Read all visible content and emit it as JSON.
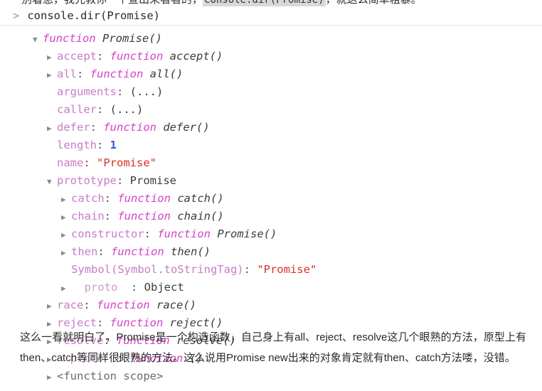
{
  "article": {
    "top_clipped_line": {
      "before_code": "别着急，我先教你一个查出来看看的，",
      "code": "console.dir(Promise)",
      "after_code": "，就这么简单粗暴。"
    },
    "bottom_paragraph": "这么一看就明白了，Promise是一个构造函数，自己身上有all、reject、resolve这几个眼熟的方法，原型上有then、catch等同样很眼熟的方法。这么说用Promise new出来的对象肯定就有then、catch方法喽，没错。"
  },
  "console": {
    "prompt_caret": ">",
    "input_text": "console.dir(Promise)",
    "tree": [
      {
        "level": 0,
        "arrow": "open",
        "kw": "function",
        "fname": "Promise()"
      },
      {
        "level": 1,
        "arrow": "closed",
        "prop": "accept",
        "sep": ": ",
        "kw": "function",
        "fname": "accept()"
      },
      {
        "level": 1,
        "arrow": "closed",
        "prop": "all",
        "sep": ": ",
        "kw": "function",
        "fname": "all()"
      },
      {
        "level": 1,
        "arrow": "none",
        "prop": "arguments",
        "sep": ": ",
        "plain": "(...)"
      },
      {
        "level": 1,
        "arrow": "none",
        "prop": "caller",
        "sep": ": ",
        "plain": "(...)"
      },
      {
        "level": 1,
        "arrow": "closed",
        "prop": "defer",
        "sep": ": ",
        "kw": "function",
        "fname": "defer()"
      },
      {
        "level": 1,
        "arrow": "none",
        "prop": "length",
        "sep": ": ",
        "num": "1"
      },
      {
        "level": 1,
        "arrow": "none",
        "prop": "name",
        "sep": ": ",
        "str": "\"Promise\""
      },
      {
        "level": 1,
        "arrow": "open",
        "prop": "prototype",
        "sep": ": ",
        "plain": "Promise"
      },
      {
        "level": 2,
        "arrow": "closed",
        "prop": "catch",
        "sep": ": ",
        "kw": "function",
        "fname": "catch()"
      },
      {
        "level": 2,
        "arrow": "closed",
        "prop": "chain",
        "sep": ": ",
        "kw": "function",
        "fname": "chain()"
      },
      {
        "level": 2,
        "arrow": "closed",
        "prop": "constructor",
        "sep": ": ",
        "kw": "function",
        "fname": "Promise()"
      },
      {
        "level": 2,
        "arrow": "closed",
        "prop": "then",
        "sep": ": ",
        "kw": "function",
        "fname": "then()"
      },
      {
        "level": 2,
        "arrow": "none",
        "symbol": "Symbol(Symbol.toStringTag)",
        "sep": ": ",
        "str": "\"Promise\""
      },
      {
        "level": 2,
        "arrow": "closed",
        "propfaint": "  proto  ",
        "sep": ": ",
        "plain": "Object"
      },
      {
        "level": 1,
        "arrow": "closed",
        "prop": "race",
        "sep": ": ",
        "kw": "function",
        "fname": "race()"
      },
      {
        "level": 1,
        "arrow": "closed",
        "prop": "reject",
        "sep": ": ",
        "kw": "function",
        "fname": "reject()"
      },
      {
        "level": 1,
        "arrow": "closed",
        "prop": "resolve",
        "sep": ": ",
        "kw": "function",
        "fname": "resolve()"
      },
      {
        "level": 1,
        "arrow": "closed",
        "propfaint": "  proto  ",
        "sep": ": ",
        "kw": "function",
        "fname": "()"
      },
      {
        "level": 1,
        "arrow": "closed",
        "dim": "<function scope>"
      }
    ]
  },
  "colors": {
    "property": "#c77cc7",
    "keyword": "#d442c6",
    "string": "#d93025",
    "number": "#3b55c9",
    "function_name": "#3b3b3b",
    "arrow": "#8a8a8a",
    "inline_code_bg": "#d8d8d8"
  }
}
